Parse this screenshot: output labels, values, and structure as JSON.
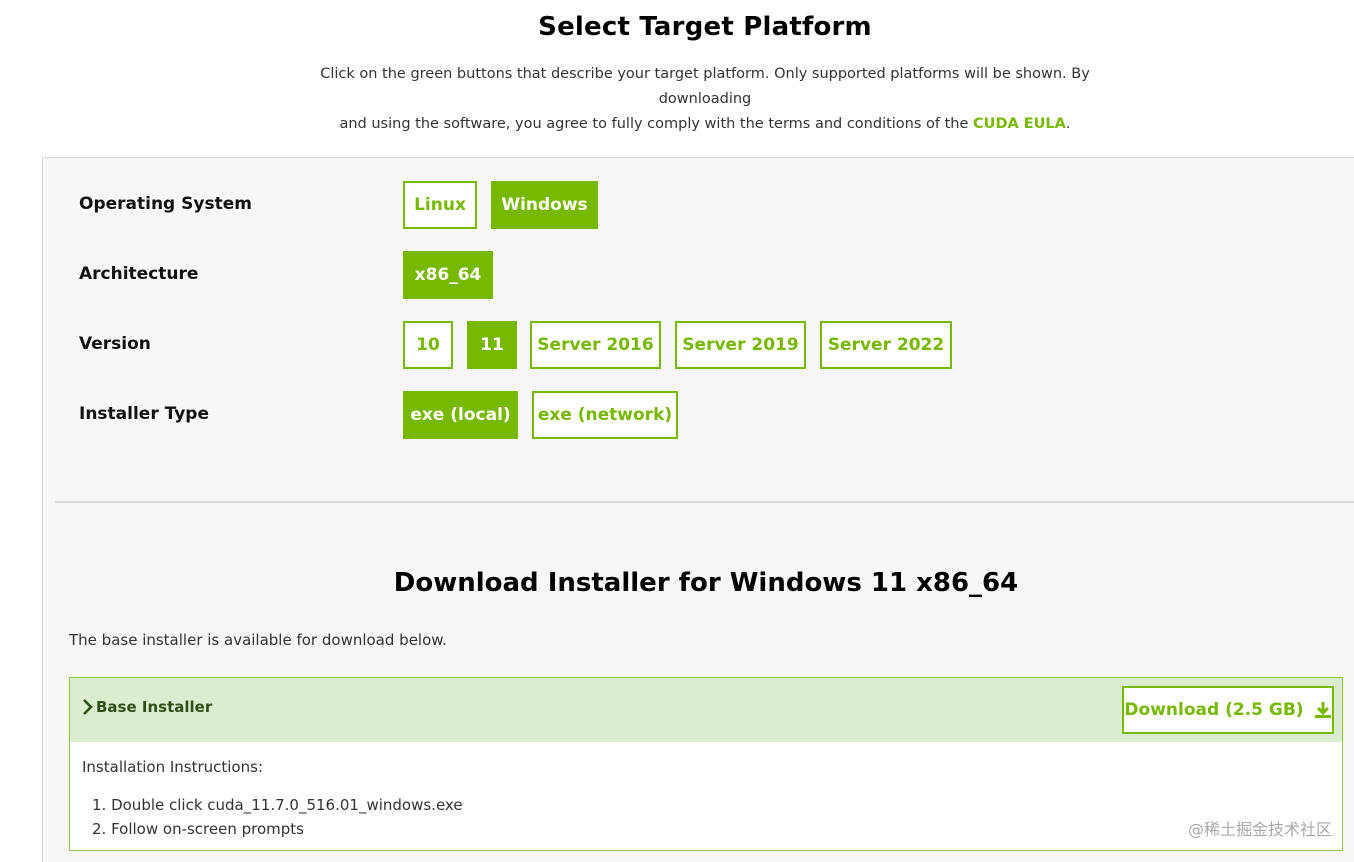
{
  "header": {
    "title": "Select Target Platform",
    "desc_line1": "Click on the green buttons that describe your target platform. Only supported platforms will be shown. By downloading",
    "desc_line2_pre": "and using the software, you agree to fully comply with the terms and conditions of the ",
    "eula_link": "CUDA EULA",
    "desc_line2_post": "."
  },
  "selector": {
    "os": {
      "label": "Operating System",
      "options": [
        "Linux",
        "Windows"
      ],
      "selected": "Windows"
    },
    "arch": {
      "label": "Architecture",
      "options": [
        "x86_64"
      ],
      "selected": "x86_64"
    },
    "version": {
      "label": "Version",
      "options": [
        "10",
        "11",
        "Server 2016",
        "Server 2019",
        "Server 2022"
      ],
      "selected": "11"
    },
    "installer": {
      "label": "Installer Type",
      "options": [
        "exe (local)",
        "exe (network)"
      ],
      "selected": "exe (local)"
    }
  },
  "download": {
    "title": "Download Installer for Windows 11 x86_64",
    "desc": "The base installer is available for download below.",
    "base_label": "Base Installer",
    "button_label": "Download (2.5 GB)",
    "instructions_title": "Installation Instructions:",
    "steps": [
      "1. Double click cuda_11.7.0_516.01_windows.exe",
      "2. Follow on-screen prompts"
    ]
  },
  "watermark": "@稀土掘金技术社区",
  "colors": {
    "accent": "#76b900",
    "panel_bg": "#f7f7f7",
    "base_head_bg": "#dbedcf"
  }
}
